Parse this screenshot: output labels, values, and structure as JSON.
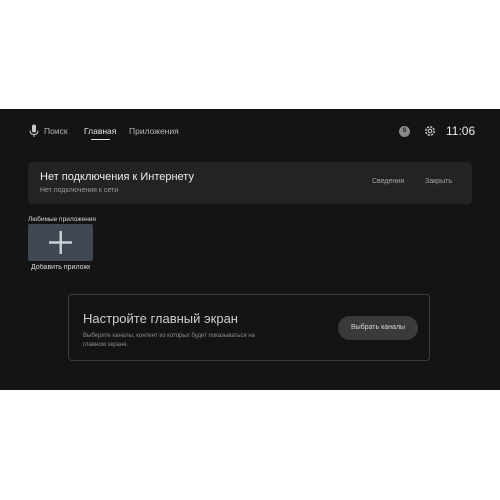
{
  "topbar": {
    "tabs": [
      {
        "label": "Поиск",
        "icon": "mic-icon"
      },
      {
        "label": "Главная",
        "active": true
      },
      {
        "label": "Приложения"
      }
    ],
    "profile_letter": "S",
    "settings_icon": "gear-icon",
    "clock": "11:06"
  },
  "notice": {
    "title": "Нет подключения к Интернету",
    "subtitle": "Нет подключения к сети",
    "details_label": "Сведения",
    "close_label": "Закрыть"
  },
  "favorites": {
    "title": "Любимые приложения",
    "add_label": "Добавить приложение",
    "add_icon": "plus-icon"
  },
  "setup": {
    "title": "Настройте главный экран",
    "description": "Выберите каналы, контент из которых будет показываться на главном экране.",
    "button_label": "Выбрать каналы"
  },
  "colors": {
    "background": "#141414",
    "card": "#232323",
    "tile": "#3f4752",
    "button": "#3a3a3a"
  }
}
